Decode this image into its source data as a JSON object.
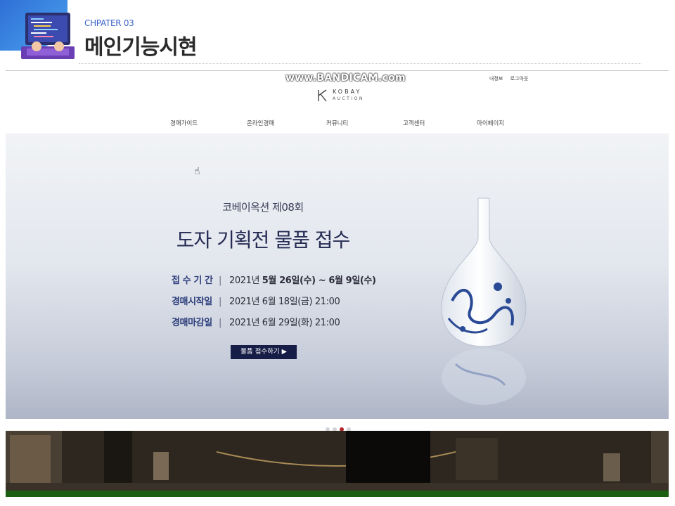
{
  "slide": {
    "chapter": "CHPATER 03",
    "title": "메인기능시현"
  },
  "watermark": "www.BANDICAM.com",
  "site": {
    "top_links": [
      "내정보",
      "로그아웃"
    ],
    "logo_line1": "KOBAY",
    "logo_line2": "AUCTION",
    "nav": [
      "경매가이드",
      "온라인경매",
      "커뮤니티",
      "고객센터",
      "마이페이지"
    ]
  },
  "hero": {
    "subtitle": "코베이옥션 제08회",
    "title": "도자 기획전 물품 접수",
    "rows": [
      {
        "label": "접 수 기 간",
        "prefix": "2021년 ",
        "value": "5월 26일(수) ~ 6월 9일(수)",
        "bold": true
      },
      {
        "label": "경매시작일",
        "prefix": "",
        "value": "2021년 6월 18일(금) 21:00",
        "bold": false
      },
      {
        "label": "경매마감일",
        "prefix": "",
        "value": "2021년 6월 29일(화) 21:00",
        "bold": false
      }
    ],
    "button_label": "물품 접수하기 ▶",
    "slide_count": 4,
    "active_slide": 3
  },
  "colors": {
    "accent_navy": "#161d46",
    "active_dot": "#b3262a",
    "footer_green": "#1c5e12"
  }
}
